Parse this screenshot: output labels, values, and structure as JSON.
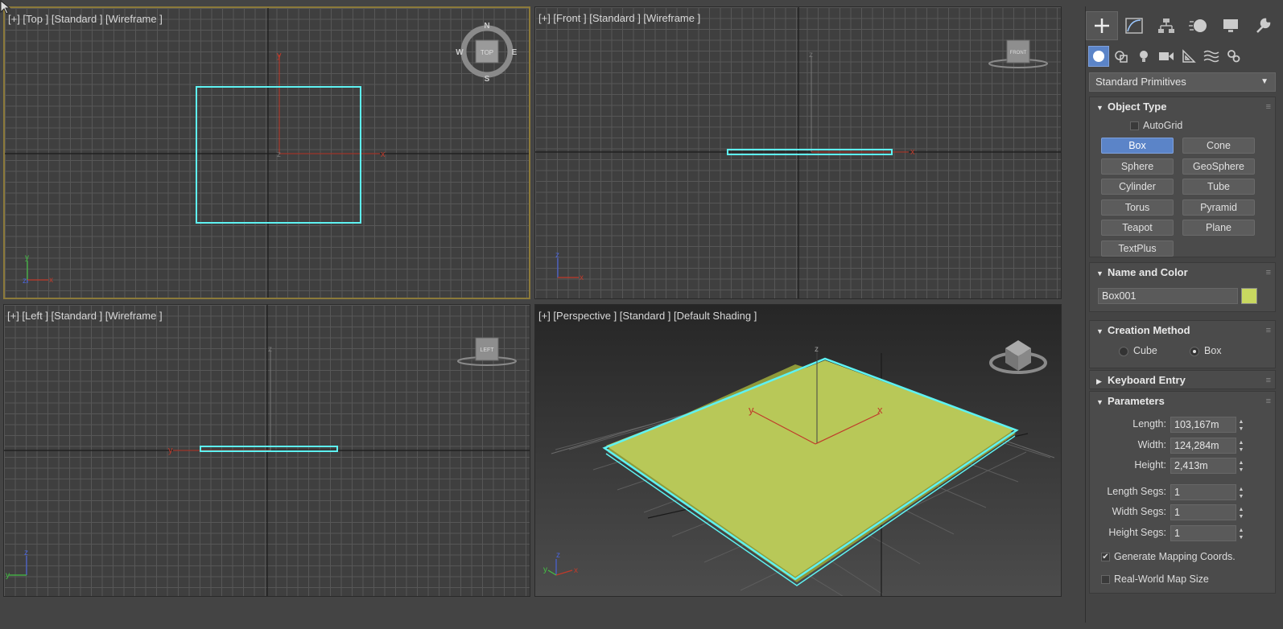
{
  "viewports": {
    "top": {
      "label": "[+] [Top ] [Standard ] [Wireframe ]",
      "compass": {
        "n": "N",
        "s": "S",
        "e": "E",
        "w": "W",
        "cube": "TOP"
      }
    },
    "front": {
      "label": "[+] [Front ] [Standard ] [Wireframe ]",
      "cube": "FRONT"
    },
    "left": {
      "label": "[+] [Left ] [Standard ] [Wireframe ]",
      "cube": "LEFT"
    },
    "perspective": {
      "label": "[+] [Perspective ] [Standard ] [Default Shading ]"
    }
  },
  "axes": {
    "x": "x",
    "y": "y",
    "z": "z"
  },
  "panel": {
    "dropdown": "Standard Primitives",
    "object_type": {
      "title": "Object Type",
      "autogrid": "AutoGrid",
      "buttons": [
        "Box",
        "Cone",
        "Sphere",
        "GeoSphere",
        "Cylinder",
        "Tube",
        "Torus",
        "Pyramid",
        "Teapot",
        "Plane",
        "TextPlus"
      ]
    },
    "name_color": {
      "title": "Name and Color",
      "name": "Box001",
      "color": "#c8d860"
    },
    "creation_method": {
      "title": "Creation Method",
      "cube": "Cube",
      "box": "Box"
    },
    "keyboard_entry": {
      "title": "Keyboard Entry"
    },
    "parameters": {
      "title": "Parameters",
      "length_label": "Length:",
      "length": "103,167m",
      "width_label": "Width:",
      "width": "124,284m",
      "height_label": "Height:",
      "height": "2,413m",
      "length_segs_label": "Length Segs:",
      "length_segs": "1",
      "width_segs_label": "Width Segs:",
      "width_segs": "1",
      "height_segs_label": "Height Segs:",
      "height_segs": "1",
      "gen_mapping": "Generate Mapping Coords.",
      "real_world": "Real-World Map Size"
    }
  },
  "colors": {
    "selection": "#5ef2f2",
    "object": "#b8c858",
    "accent": "#5b84c8"
  }
}
